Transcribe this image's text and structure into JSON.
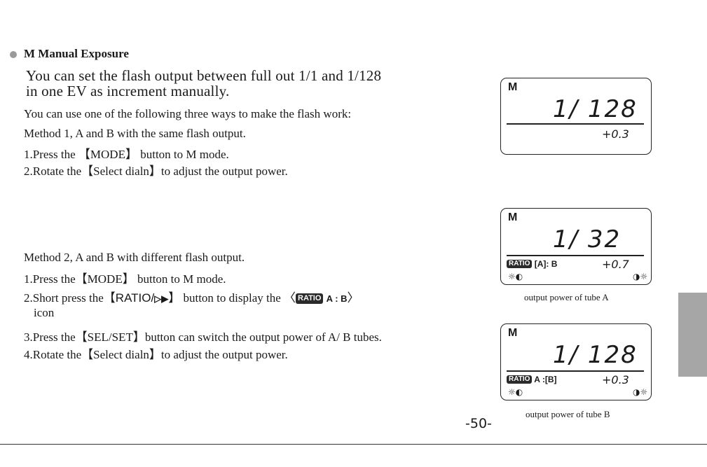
{
  "section": {
    "heading": "M Manual Exposure",
    "intro_line1": "You can set the flash output between full out 1/1 and 1/128",
    "intro_line2": "in one EV as increment manually.",
    "ways_line": "You can use one of the following three ways to make the flash work:"
  },
  "method1": {
    "title": "Method 1, A and B with the same flash output.",
    "step1": "1.Press the 【MODE】 button to M mode.",
    "step2": "2.Rotate the【Select dialn】to adjust the output power."
  },
  "method2": {
    "title": "Method 2, A and B with different flash output.",
    "step1": "1.Press the【MODE】 button to M mode.",
    "step2_prefix": "2.Short press the【",
    "step2_button": "RATIO/",
    "step2_arrow": "▷▶",
    "step2_mid": "】 button to display the 〈",
    "step2_badge": "RATIO",
    "step2_ab": "A : B",
    "step2_close": "〉",
    "step2_cont": "icon",
    "step3": "3.Press the【SEL/SET】button can switch the output power of A/ B tubes.",
    "step4": "4.Rotate the【Select dialn】to adjust the output power."
  },
  "lcd1": {
    "mode": "M",
    "power": "1/ 128",
    "ev": "+0.3"
  },
  "lcd2": {
    "mode": "M",
    "power": "1/ 32",
    "ratio_badge": "RATIO",
    "ratio_text": "[A]: B",
    "ev": "+0.7",
    "icon_left": "☼◐",
    "icon_right": "◑☼",
    "caption": "output power of tube A"
  },
  "lcd3": {
    "mode": "M",
    "power": "1/ 128",
    "ratio_badge": "RATIO",
    "ratio_text": "A :[B]",
    "ev": "+0.3",
    "icon_left": "☼◐",
    "icon_right": "◑☼",
    "caption": "output power of tube B"
  },
  "page_number": "-50-",
  "colors": {
    "bullet": "#9a9a9a",
    "side_tab": "#a6a6a6",
    "text": "#1a1a1a"
  }
}
